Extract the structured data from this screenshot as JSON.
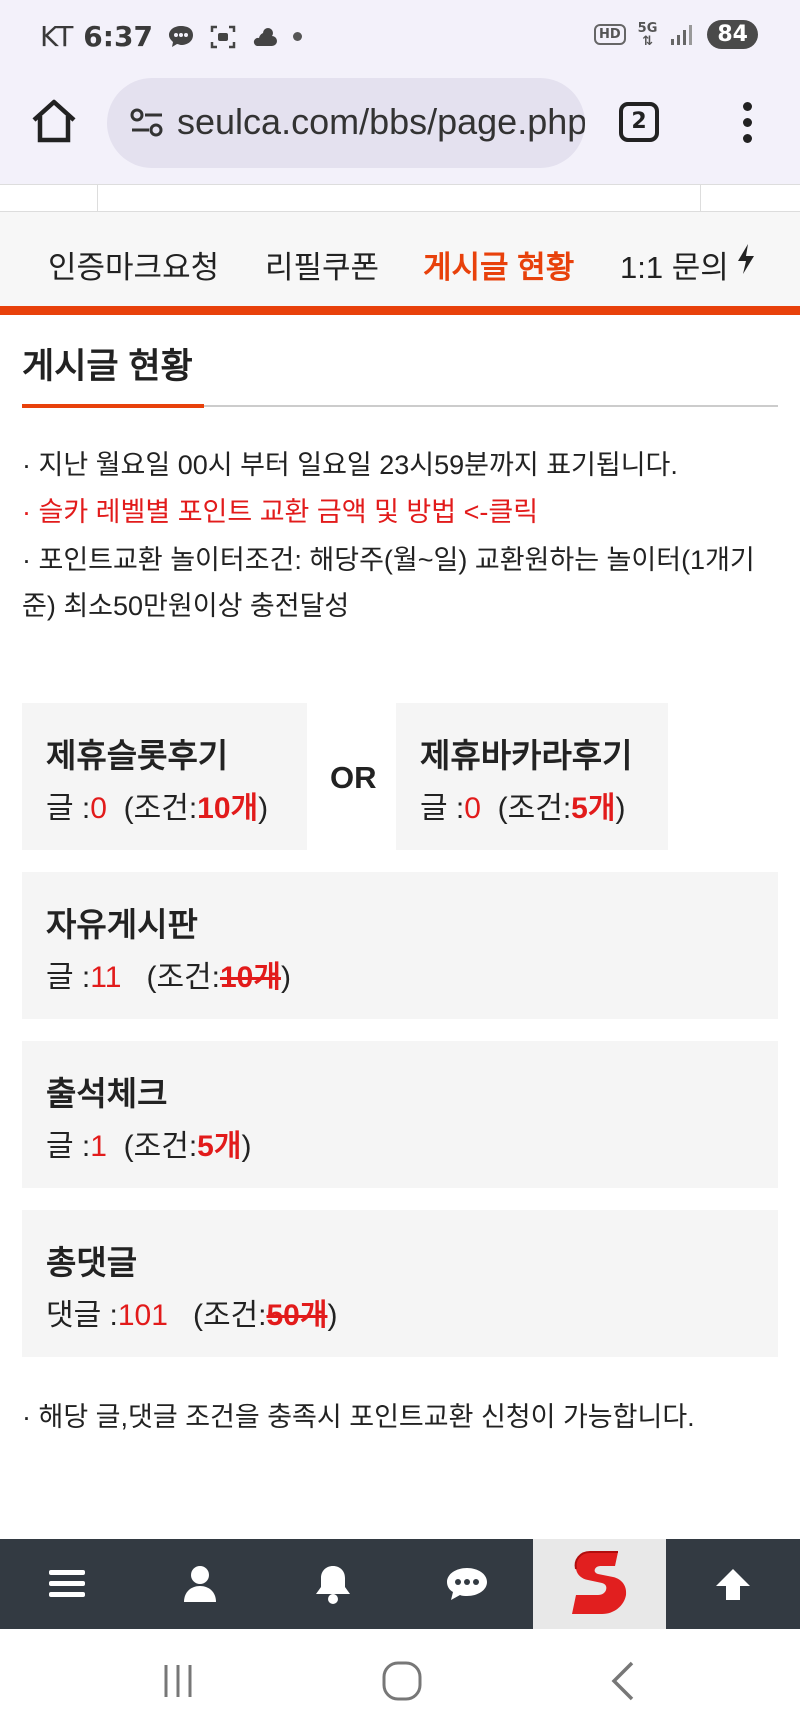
{
  "status_bar": {
    "carrier": "KT",
    "time": "6:37",
    "hd_badge": "HD",
    "network": "5G",
    "battery": "84"
  },
  "browser": {
    "url": "seulca.com/bbs/page.php",
    "tab_count": "2"
  },
  "submenu": {
    "items": [
      {
        "label": "인증마크요청",
        "active": false
      },
      {
        "label": "리필쿠폰",
        "active": false
      },
      {
        "label": "게시글 현황",
        "active": true
      },
      {
        "label": "1:1 문의",
        "active": false
      }
    ]
  },
  "page": {
    "title": "게시글 현황",
    "notes": [
      "· 지난 월요일 00시 부터 일요일 23시59분까지 표기됩니다.",
      "· 슬카 레벨별 포인트 교환 금액 및 방법 <-클릭",
      "· 포인트교환 놀이터조건: 해당주(월~일) 교환원하는 놀이터(1개기준) 최소50만원이상 충전달성"
    ],
    "or_label": "OR",
    "cards": [
      {
        "title": "제휴슬롯후기",
        "count_label": "글 :",
        "count": "0",
        "cond_prefix": "(조건:",
        "cond_value": "10개",
        "cond_suffix": ")",
        "met": false
      },
      {
        "title": "제휴바카라후기",
        "count_label": "글 :",
        "count": "0",
        "cond_prefix": "(조건:",
        "cond_value": "5개",
        "cond_suffix": ")",
        "met": false
      },
      {
        "title": "자유게시판",
        "count_label": "글 :",
        "count": "11",
        "cond_prefix": "(조건:",
        "cond_value": "10개",
        "cond_suffix": ")",
        "met": true
      },
      {
        "title": "출석체크",
        "count_label": "글 :",
        "count": "1",
        "cond_prefix": "(조건:",
        "cond_value": "5개",
        "cond_suffix": ")",
        "met": false
      },
      {
        "title": "총댓글",
        "count_label": "댓글 :",
        "count": "101",
        "cond_prefix": "(조건:",
        "cond_value": "50개",
        "cond_suffix": ")",
        "met": true
      }
    ],
    "bottom_note": "· 해당 글,댓글 조건을 충족시 포인트교환 신청이 가능합니다."
  },
  "bottom_nav": {
    "icons": [
      "menu-icon",
      "user-icon",
      "bell-icon",
      "chat-icon",
      "logo",
      "arrow-up-icon"
    ]
  },
  "colors": {
    "accent": "#e8410b",
    "red_text": "#e21b1b",
    "bottom_nav_bg": "#333a42"
  }
}
